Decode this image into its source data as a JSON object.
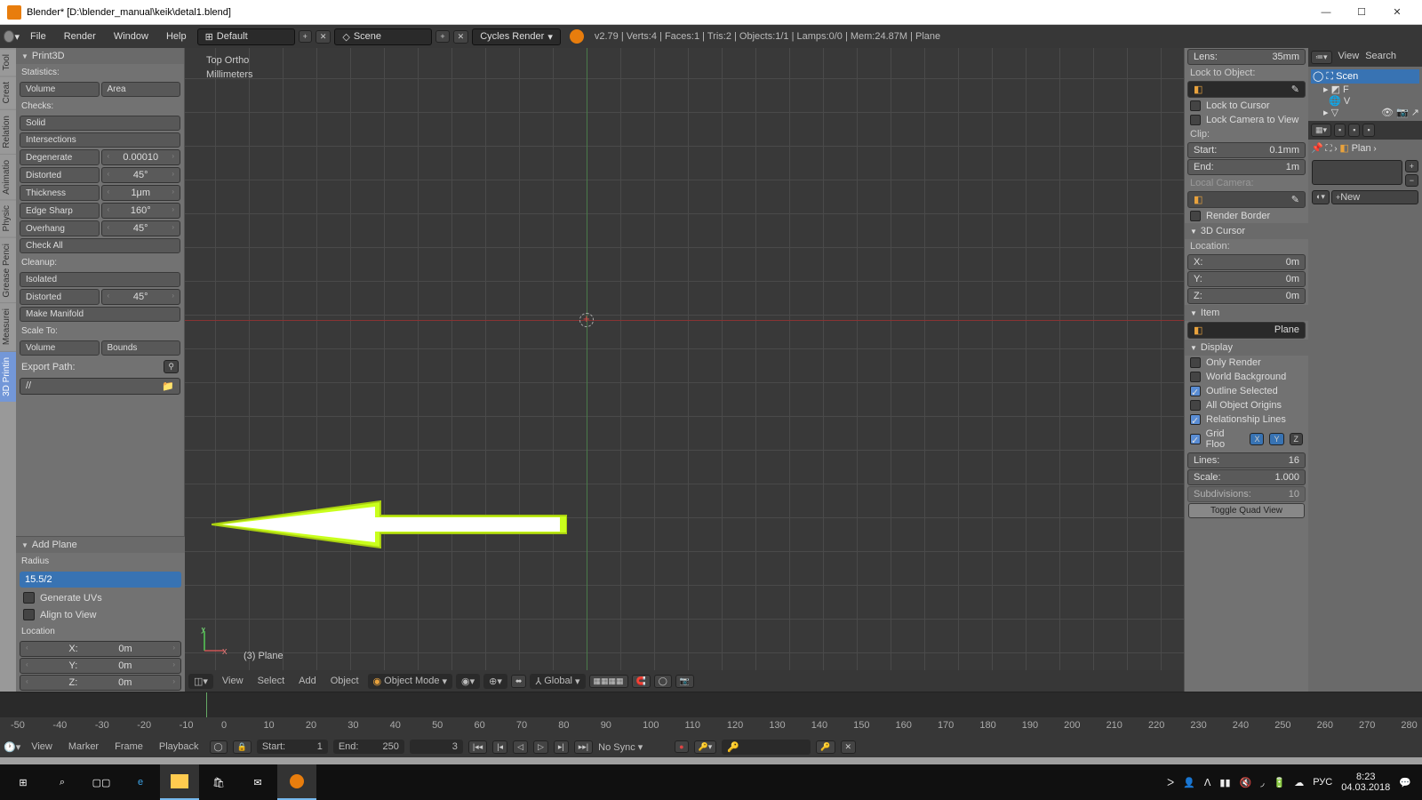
{
  "window": {
    "title": "Blender* [D:\\blender_manual\\keik\\detal1.blend]"
  },
  "topmenu": {
    "file": "File",
    "render": "Render",
    "window": "Window",
    "help": "Help",
    "layout": "Default",
    "scene": "Scene",
    "engine": "Cycles Render",
    "stats": "v2.79 | Verts:4 | Faces:1 | Tris:2 | Objects:1/1 | Lamps:0/0 | Mem:24.87M | Plane"
  },
  "sidetabs": [
    "Tool",
    "Creat",
    "Relation",
    "Animatio",
    "Physic",
    "Grease Penci",
    "Measurei",
    "3D Printin"
  ],
  "print3d": {
    "title": "Print3D",
    "stats": "Statistics:",
    "volume": "Volume",
    "area": "Area",
    "checks": "Checks:",
    "solid": "Solid",
    "intersections": "Intersections",
    "degenerate": "Degenerate",
    "degenerate_v": "0.00010",
    "distorted": "Distorted",
    "distorted_v": "45°",
    "thickness": "Thickness",
    "thickness_v": "1μm",
    "edgesharp": "Edge Sharp",
    "edgesharp_v": "160°",
    "overhang": "Overhang",
    "overhang_v": "45°",
    "checkall": "Check All",
    "cleanup": "Cleanup:",
    "isolated": "Isolated",
    "distorted2": "Distorted",
    "distorted2_v": "45°",
    "manifold": "Make Manifold",
    "scaleto": "Scale To:",
    "volume2": "Volume",
    "bounds": "Bounds",
    "export": "Export Path:",
    "exportpath": "//"
  },
  "operator": {
    "title": "Add Plane",
    "radius_lbl": "Radius",
    "radius": "15.5/2",
    "genuv": "Generate UVs",
    "align": "Align to View",
    "location": "Location",
    "x": "X:",
    "y": "Y:",
    "z": "Z:",
    "xv": "0m",
    "yv": "0m",
    "zv": "0m"
  },
  "viewport": {
    "view": "Top Ortho",
    "units": "Millimeters",
    "objname": "(3) Plane"
  },
  "npanel": {
    "lens": "Lens:",
    "lens_v": "35mm",
    "locklabel": "Lock to Object:",
    "lockcursor": "Lock to Cursor",
    "lockcam": "Lock Camera to View",
    "clip": "Clip:",
    "start": "Start:",
    "start_v": "0.1mm",
    "end": "End:",
    "end_v": "1m",
    "localcam": "Local Camera:",
    "renderborder": "Render Border",
    "cursor3d": "3D Cursor",
    "loc": "Location:",
    "x": "X:",
    "y": "Y:",
    "z": "Z:",
    "val": "0m",
    "item": "Item",
    "itemname": "Plane",
    "display": "Display",
    "onlyrender": "Only Render",
    "worldbg": "World Background",
    "outline": "Outline Selected",
    "allorigins": "All Object Origins",
    "rellines": "Relationship Lines",
    "gridfloor": "Grid Floo",
    "lines": "Lines:",
    "lines_v": "16",
    "scale": "Scale:",
    "scale_v": "1.000",
    "subdiv": "Subdivisions:",
    "subdiv_v": "10",
    "togglequad": "Toggle Quad View"
  },
  "outliner": {
    "view": "View",
    "search": "Search",
    "scene": "Scen",
    "plan": "Plan",
    "new": "New"
  },
  "vheader": {
    "mode": "Object Mode",
    "view": "View",
    "select": "Select",
    "add": "Add",
    "object": "Object",
    "orient": "Global"
  },
  "timeline": {
    "ruler": [
      "-50",
      "-40",
      "-30",
      "-20",
      "-10",
      "0",
      "10",
      "20",
      "30",
      "40",
      "50",
      "60",
      "70",
      "80",
      "90",
      "100",
      "110",
      "120",
      "130",
      "140",
      "150",
      "160",
      "170",
      "180",
      "190",
      "200",
      "210",
      "220",
      "230",
      "240",
      "250",
      "260",
      "270",
      "280"
    ],
    "view": "View",
    "marker": "Marker",
    "frame": "Frame",
    "playback": "Playback",
    "start": "Start:",
    "start_v": "1",
    "end": "End:",
    "end_v": "250",
    "cur": "3",
    "sync": "No Sync"
  },
  "taskbar": {
    "lang": "РУС",
    "time": "8:23",
    "date": "04.03.2018"
  }
}
